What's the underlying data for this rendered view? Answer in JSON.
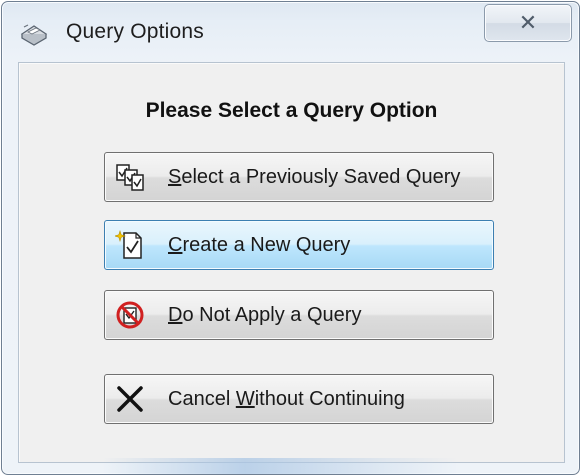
{
  "window": {
    "title": "Query Options",
    "close_glyph": "✕",
    "title_icon": "query-window-icon"
  },
  "dialog": {
    "heading": "Please Select a Query Option"
  },
  "buttons": [
    {
      "icon": "saved-queries-icon",
      "mnemonic": "S",
      "rest": "elect a Previously Saved Query",
      "label": "Select a Previously Saved Query",
      "state": "normal"
    },
    {
      "icon": "new-query-icon",
      "mnemonic": "C",
      "rest": "reate a New Query",
      "label": "Create a New Query",
      "state": "hover"
    },
    {
      "icon": "no-query-icon",
      "mnemonic": "D",
      "rest": "o Not Apply a Query",
      "label": "Do Not Apply a Query",
      "state": "normal"
    },
    {
      "icon": "cancel-x-icon",
      "before": "Cancel ",
      "mnemonic": "W",
      "rest": "ithout Continuing",
      "label": "Cancel Without Continuing",
      "state": "normal"
    }
  ],
  "colors": {
    "hover_border": "#3c7fb1",
    "hover_fill": "#bee6fd",
    "no_sign_red": "#d02020"
  }
}
